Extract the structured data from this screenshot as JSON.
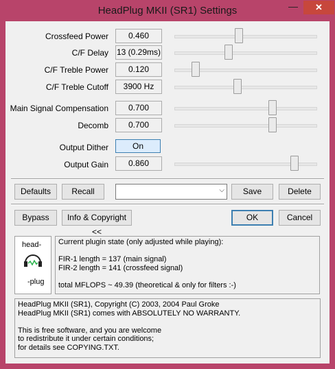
{
  "window": {
    "title": "HeadPlug MKII (SR1) Settings",
    "close_label": "✕",
    "minimize_label": "—"
  },
  "params": [
    {
      "label": "Crossfeed Power",
      "value": "0.460",
      "level": 0.45
    },
    {
      "label": "C/F Delay",
      "value": "13 (0.29ms)",
      "level": 0.37
    },
    {
      "label": "C/F Treble Power",
      "value": "0.120",
      "level": 0.13
    },
    {
      "label": "C/F Treble Cutoff",
      "value": "3900 Hz",
      "level": 0.44
    },
    {
      "label": "Main Signal Compensation",
      "value": "0.700",
      "level": 0.7
    },
    {
      "label": "Decomb",
      "value": "0.700",
      "level": 0.7
    },
    {
      "label": "Output Dither",
      "value": "On"
    },
    {
      "label": "Output Gain",
      "value": "0.860",
      "level": 0.86
    }
  ],
  "buttons": {
    "defaults": "Defaults",
    "recall": "Recall",
    "save": "Save",
    "delete": "Delete",
    "bypass": "Bypass",
    "info": "Info & Copyright <<",
    "ok": "OK",
    "cancel": "Cancel"
  },
  "preset": {
    "value": "",
    "arrow": "⌵"
  },
  "logo": {
    "line1": "head-",
    "line2": "-plug"
  },
  "plugin_state": [
    "Current plugin state (only adjusted while playing):",
    "",
    "FIR-1 length = 137 (main signal)",
    "FIR-2 length = 141 (crossfeed signal)",
    "",
    "total MFLOPS ~ 49.39 (theoretical & only for filters :-)"
  ],
  "license": [
    "HeadPlug MKII (SR1), Copyright (C) 2003, 2004 Paul Groke",
    "HeadPlug MKII (SR1) comes with ABSOLUTELY NO WARRANTY.",
    "",
    "This is free software, and you are welcome",
    "to redistribute it under certain conditions;",
    "for details see COPYING.TXT."
  ]
}
